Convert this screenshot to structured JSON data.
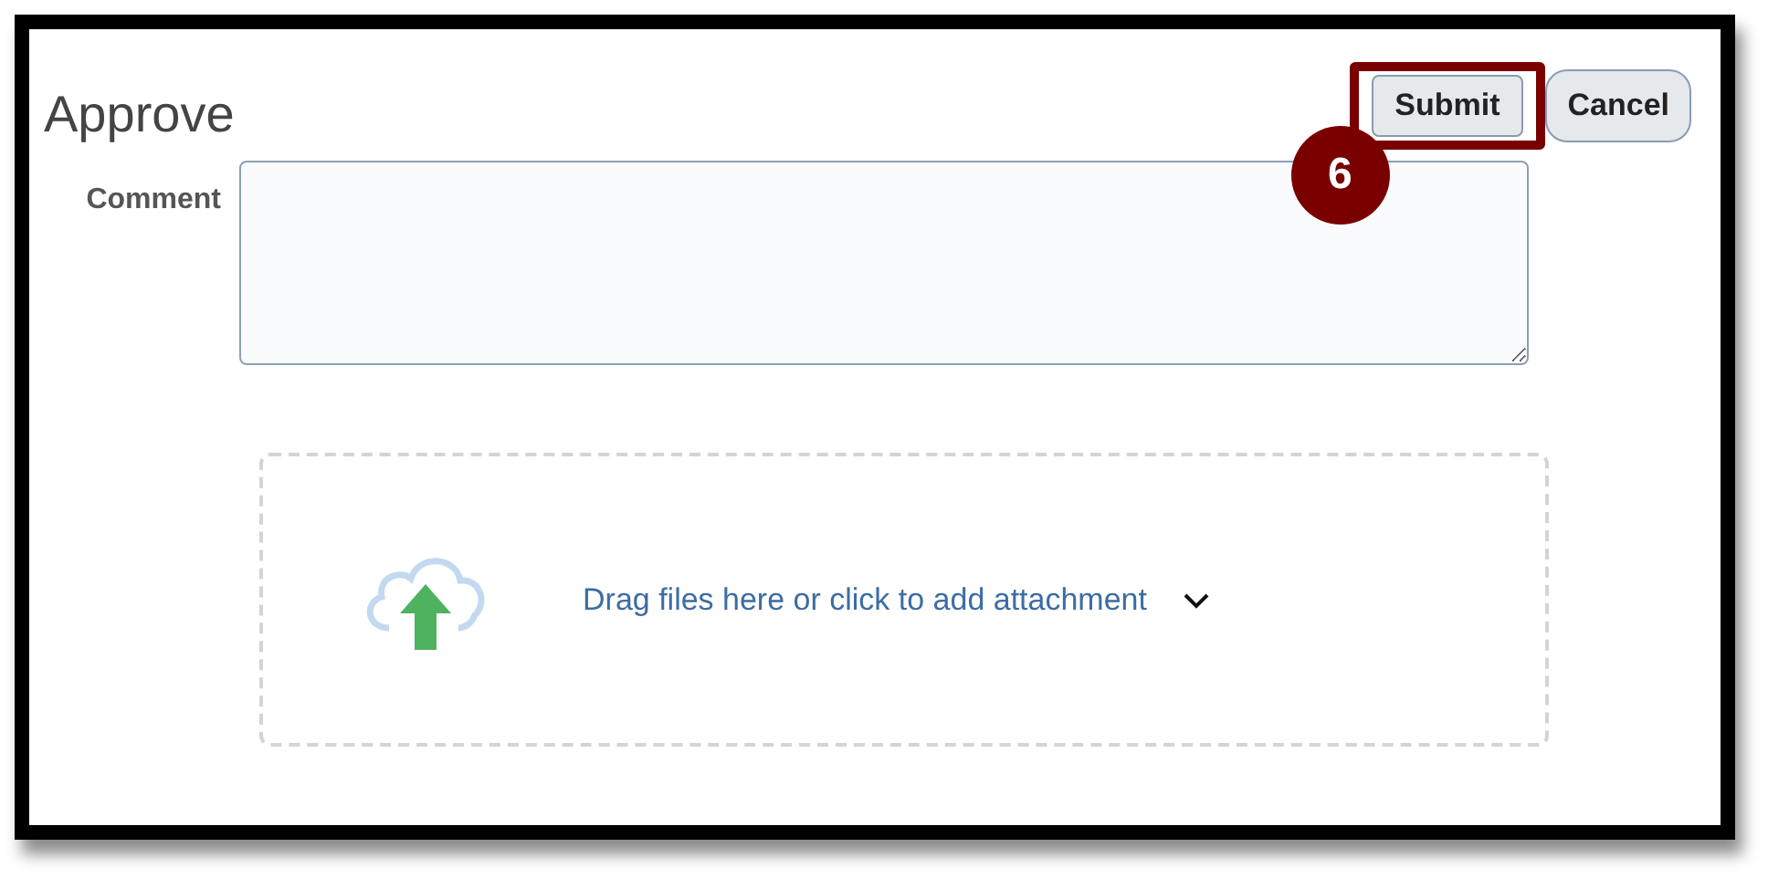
{
  "header": {
    "title": "Approve"
  },
  "buttons": [
    {
      "label": "Submit",
      "highlighted": true,
      "callout": "6"
    },
    {
      "label": "Cancel",
      "highlighted": false
    }
  ],
  "comment": {
    "label": "Comment"
  },
  "attachment": {
    "text": "Drag files here or click to add attachment"
  }
}
